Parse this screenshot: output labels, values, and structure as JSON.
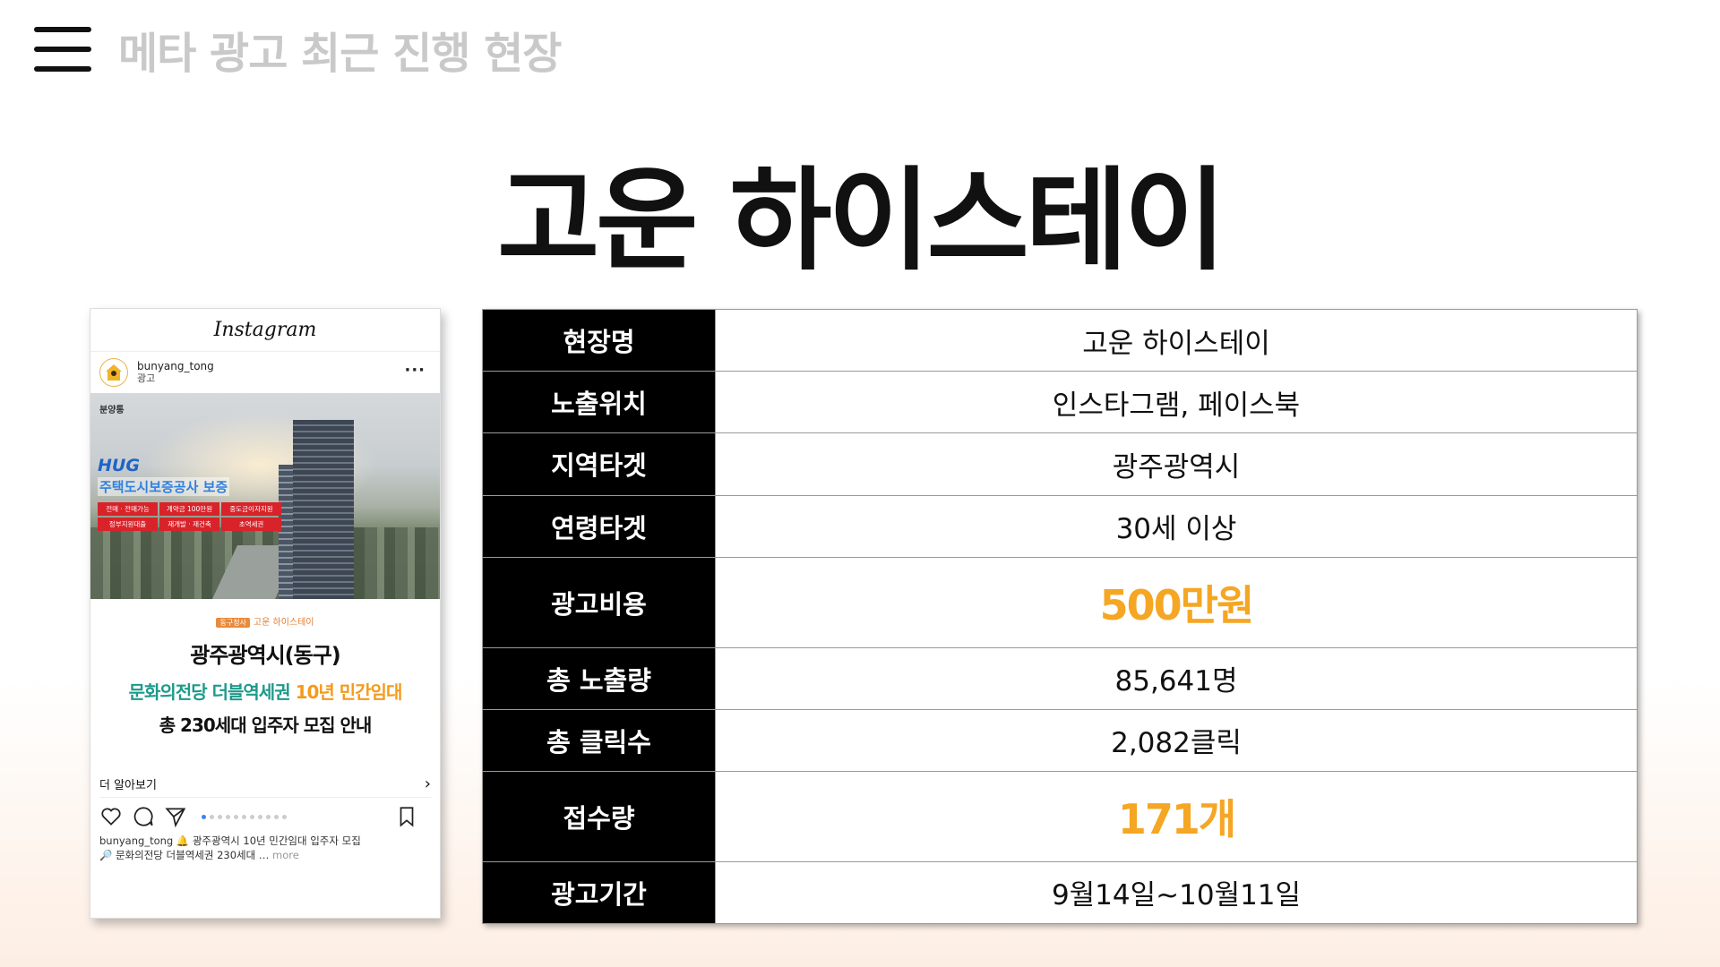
{
  "header": {
    "menu_icon": "hamburger-menu-icon",
    "title": "메타 광고 최근 진행 현장"
  },
  "main_title": "고운 하이스테이",
  "instagram_post": {
    "app_name": "Instagram",
    "username": "bunyang_tong",
    "sponsored_label": "광고",
    "more_icon": "···",
    "image": {
      "brand": "분양통",
      "hug_logo": "HUG",
      "hug_title": "주택도시보증공사 보증",
      "tags": [
        "전매 · 전매가능",
        "계약금 100만원",
        "중도금이자지원",
        "정부지원대출",
        "재개발 · 재건축",
        "초역세권"
      ]
    },
    "card": {
      "tag_label": "동구청사",
      "tag_text": "고운 하이스테이",
      "line1": "광주광역시(동구)",
      "line2_green": "문화의전당 더블역세권",
      "line2_orange": "10년 민간임대",
      "line3": "총 230세대 입주자 모집 안내"
    },
    "learn_more": "더 알아보기",
    "chevron": "›",
    "caption_user": "bunyang_tong",
    "caption_line1": "🔔 광주광역시 10년 민간임대 입주자 모집",
    "caption_line2": "🔎 문화의전당 더블역세권 230세대 …",
    "caption_more": "more",
    "accent_color": "#3b82f6"
  },
  "info": {
    "rows": [
      {
        "label": "현장명",
        "value": "고운 하이스테이",
        "highlight": false
      },
      {
        "label": "노출위치",
        "value": "인스타그램, 페이스북",
        "highlight": false
      },
      {
        "label": "지역타겟",
        "value": "광주광역시",
        "highlight": false
      },
      {
        "label": "연령타겟",
        "value": "30세 이상",
        "highlight": false
      },
      {
        "label": "광고비용",
        "value": "500만원",
        "highlight": true
      },
      {
        "label": "총 노출량",
        "value": "85,641명",
        "highlight": false
      },
      {
        "label": "총 클릭수",
        "value": "2,082클릭",
        "highlight": false
      },
      {
        "label": "접수량",
        "value": "171개",
        "highlight": true
      },
      {
        "label": "광고기간",
        "value": "9월14일~10월11일",
        "highlight": false
      }
    ],
    "highlight_color": "#f5a623",
    "label_bg": "#000000"
  }
}
